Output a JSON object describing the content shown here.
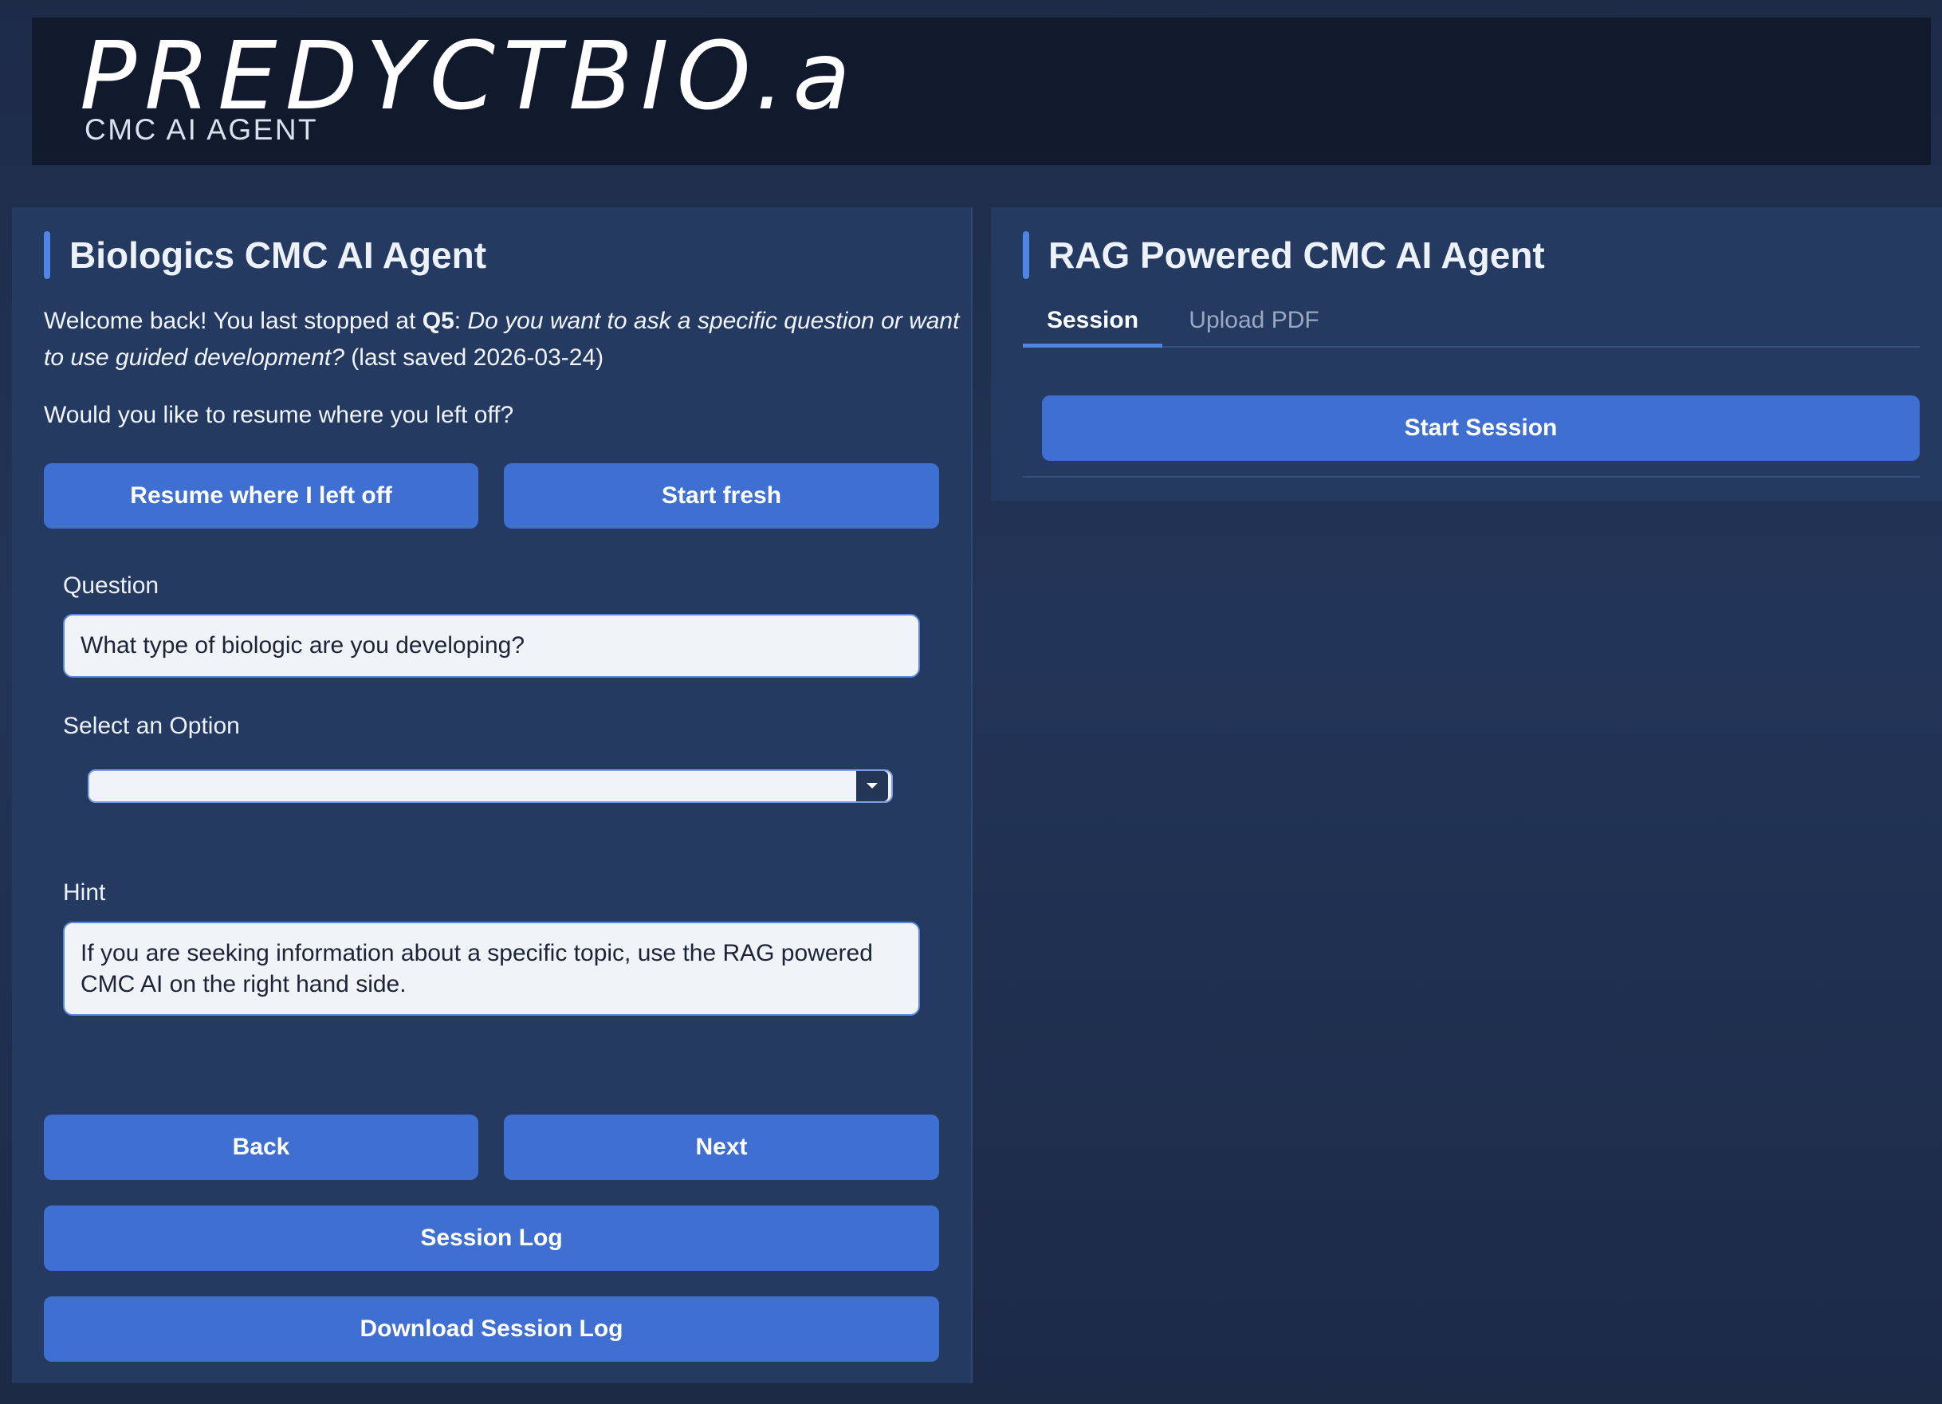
{
  "header": {
    "logo_text": "PREDYCTBIO.ai",
    "subtitle": "CMC AI AGENT"
  },
  "left_panel": {
    "title": "Biologics CMC AI Agent",
    "welcome": {
      "prefix": "Welcome back! You last stopped at ",
      "question_id": "Q5",
      "separator": ": ",
      "question_text": "Do you want to ask a specific question or want to use guided development?",
      "saved_note": " (last saved 2026-03-24)"
    },
    "resume_prompt": "Would you like to resume where you left off?",
    "resume_button": "Resume where I left off",
    "start_fresh_button": "Start fresh",
    "question_label": "Question",
    "question_value": "What type of biologic are you developing?",
    "select_label": "Select an Option",
    "select_value": "",
    "hint_label": "Hint",
    "hint_value": "If you are seeking information about a specific topic, use the RAG powered CMC AI on the right hand side.",
    "back_button": "Back",
    "next_button": "Next",
    "session_log_button": "Session Log",
    "download_log_button": "Download Session Log"
  },
  "right_panel": {
    "title": "RAG Powered CMC AI Agent",
    "tabs": [
      {
        "label": "Session",
        "active": true
      },
      {
        "label": "Upload PDF",
        "active": false
      }
    ],
    "start_session_button": "Start Session"
  },
  "colors": {
    "accent_button": "#3f6fd1",
    "panel_background": "#243a60",
    "header_background": "#111a2d",
    "title_bar": "#4f86e6"
  }
}
